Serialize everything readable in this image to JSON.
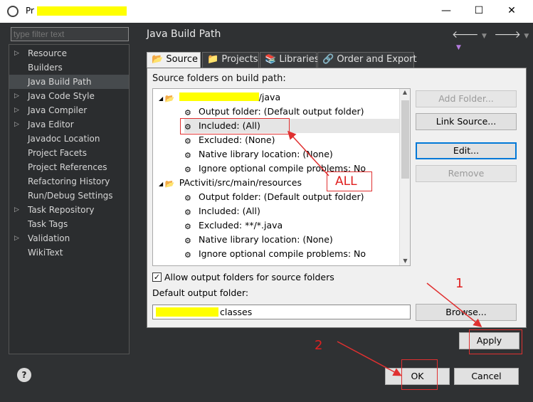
{
  "window": {
    "title": "Pr",
    "controls": {
      "minimize": "—",
      "maximize": "☐",
      "close": "✕"
    }
  },
  "filter": {
    "placeholder": "type filter text"
  },
  "sidebar": {
    "items": [
      {
        "label": "Resource",
        "expandable": true
      },
      {
        "label": "Builders",
        "expandable": false
      },
      {
        "label": "Java Build Path",
        "expandable": false,
        "selected": true
      },
      {
        "label": "Java Code Style",
        "expandable": true
      },
      {
        "label": "Java Compiler",
        "expandable": true
      },
      {
        "label": "Java Editor",
        "expandable": true
      },
      {
        "label": "Javadoc Location",
        "expandable": false
      },
      {
        "label": "Project Facets",
        "expandable": false
      },
      {
        "label": "Project References",
        "expandable": false
      },
      {
        "label": "Refactoring History",
        "expandable": false
      },
      {
        "label": "Run/Debug Settings",
        "expandable": false
      },
      {
        "label": "Task Repository",
        "expandable": true
      },
      {
        "label": "Task Tags",
        "expandable": false
      },
      {
        "label": "Validation",
        "expandable": true
      },
      {
        "label": "WikiText",
        "expandable": false
      }
    ]
  },
  "header": {
    "title": "Java Build Path"
  },
  "tabs": [
    {
      "label": "Source",
      "active": true
    },
    {
      "label": "Projects"
    },
    {
      "label": "Libraries"
    },
    {
      "label": "Order and Export"
    }
  ],
  "source": {
    "label": "Source folders on build path:",
    "tree": [
      {
        "text": "/java",
        "indent": 0,
        "expanded": true,
        "folder": true,
        "redacted": true
      },
      {
        "text": "Output folder: (Default output folder)",
        "indent": 1
      },
      {
        "text": "Included: (All)",
        "indent": 1,
        "selected": true
      },
      {
        "text": "Excluded: (None)",
        "indent": 1
      },
      {
        "text": "Native library location: (None)",
        "indent": 1
      },
      {
        "text": "Ignore optional compile problems: No",
        "indent": 1
      },
      {
        "text": "PActiviti/src/main/resources",
        "indent": 0,
        "expanded": true,
        "folder": true
      },
      {
        "text": "Output folder: (Default output folder)",
        "indent": 1
      },
      {
        "text": "Included: (All)",
        "indent": 1
      },
      {
        "text": "Excluded: **/*.java",
        "indent": 1
      },
      {
        "text": "Native library location: (None)",
        "indent": 1
      },
      {
        "text": "Ignore optional compile problems: No",
        "indent": 1
      }
    ],
    "buttons": {
      "add_folder": "Add Folder...",
      "link_source": "Link Source...",
      "edit": "Edit...",
      "remove": "Remove"
    },
    "allow_output_label": "Allow output folders for source folders",
    "allow_output_checked": true,
    "default_output_label": "Default output folder:",
    "default_output_value": "classes"
  },
  "footer": {
    "apply": "Apply",
    "ok": "OK",
    "cancel": "Cancel",
    "help": "?"
  },
  "annotations": {
    "all": "ALL",
    "step1": "1",
    "step2": "2"
  }
}
